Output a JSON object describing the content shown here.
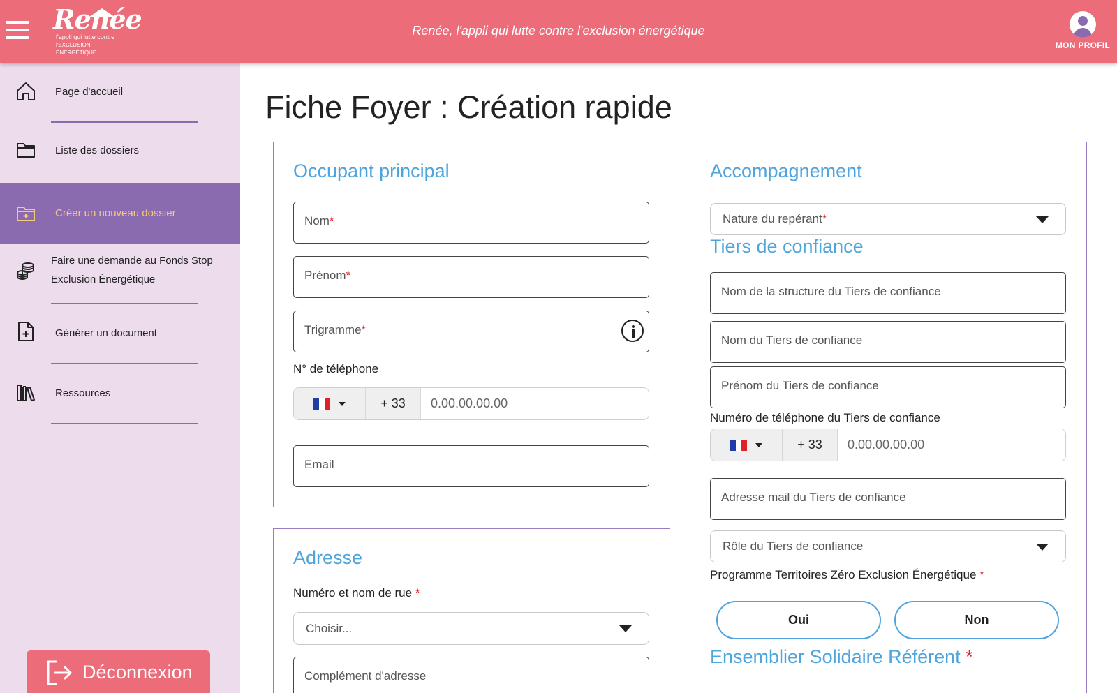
{
  "header": {
    "logo_name": "Renée",
    "logo_tagline_1": "l'appli qui lutte contre",
    "logo_tagline_2": "l'EXCLUSION ÉNERGÉTIQUE",
    "title": "Renée, l'appli qui lutte contre l'exclusion énergétique",
    "profile_label": "MON PROFIL"
  },
  "sidebar": {
    "items": [
      {
        "label": "Page d'accueil",
        "icon": "home-icon"
      },
      {
        "label": "Liste des dossiers",
        "icon": "folder-icon"
      },
      {
        "label": "Créer un nouveau dossier",
        "icon": "folder-plus-icon",
        "active": true
      },
      {
        "label_1": "Faire une demande au Fonds Stop",
        "label_2": "Exclusion Énergétique",
        "icon": "coins-icon"
      },
      {
        "label": "Générer un document",
        "icon": "document-plus-icon"
      },
      {
        "label": "Ressources",
        "icon": "books-icon"
      }
    ],
    "logout_label": "Déconnexion"
  },
  "main": {
    "page_title": "Fiche Foyer : Création rapide",
    "occupant": {
      "title": "Occupant principal",
      "nom": "Nom",
      "prenom": "Prénom",
      "trigramme": "Trigramme",
      "phone_label": "N° de téléphone",
      "phone_code": "+ 33",
      "phone_placeholder": "0.00.00.00.00",
      "email": "Email",
      "required_mark": "*"
    },
    "adresse": {
      "title": "Adresse",
      "street_label": "Numéro et nom de rue",
      "street_placeholder": "Choisir...",
      "complement": "Complément d'adresse",
      "required_mark": "*"
    },
    "accompagnement": {
      "title": "Accompagnement",
      "nature": "Nature du repérant",
      "required_mark": "*"
    },
    "tiers": {
      "title": "Tiers de confiance",
      "structure": "Nom de la structure du Tiers de confiance",
      "nom": "Nom du Tiers de confiance",
      "prenom": "Prénom du Tiers de confiance",
      "phone_label": "Numéro de téléphone du Tiers de confiance",
      "phone_code": "+ 33",
      "phone_placeholder": "0.00.00.00.00",
      "email": "Adresse mail du Tiers de confiance",
      "role": "Rôle du Tiers de confiance",
      "programme_label": "Programme Territoires Zéro Exclusion Énergétique",
      "oui": "Oui",
      "non": "Non",
      "ensemblier_title": "Ensemblier Solidaire Référent",
      "required_mark": "*"
    }
  },
  "colors": {
    "header": "#ec6c79",
    "sidebar_bg": "#ecdcec",
    "accent_purple": "#8a6bb0",
    "active_text": "#f7c97a",
    "title_blue": "#4ea4dc",
    "required": "#e0202a"
  }
}
